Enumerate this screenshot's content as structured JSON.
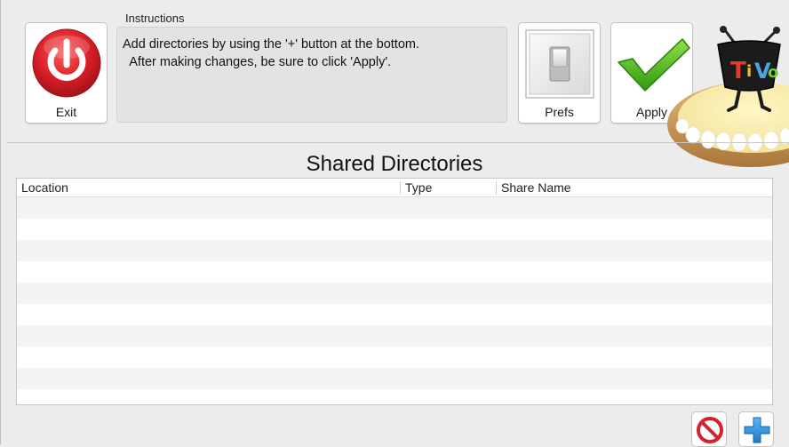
{
  "toolbar": {
    "exit_label": "Exit",
    "prefs_label": "Prefs",
    "apply_label": "Apply"
  },
  "instructions": {
    "label": "Instructions",
    "lines": [
      "Add directories by using the '+' button at the bottom.",
      "  After making changes, be sure to click 'Apply'."
    ]
  },
  "shared_directories": {
    "title": "Shared Directories",
    "columns": [
      "Location",
      "Type",
      "Share Name"
    ],
    "rows": []
  },
  "icons": {
    "exit": "power-icon",
    "prefs": "toggle-switch-icon",
    "apply": "checkmark-icon",
    "remove": "no-entry-icon",
    "add": "plus-icon",
    "logo": "tivo-pie-logo"
  },
  "colors": {
    "exit_red": "#d71f26",
    "apply_green": "#3fae1d",
    "add_blue": "#1f8ee0",
    "remove_red": "#d8202a"
  }
}
